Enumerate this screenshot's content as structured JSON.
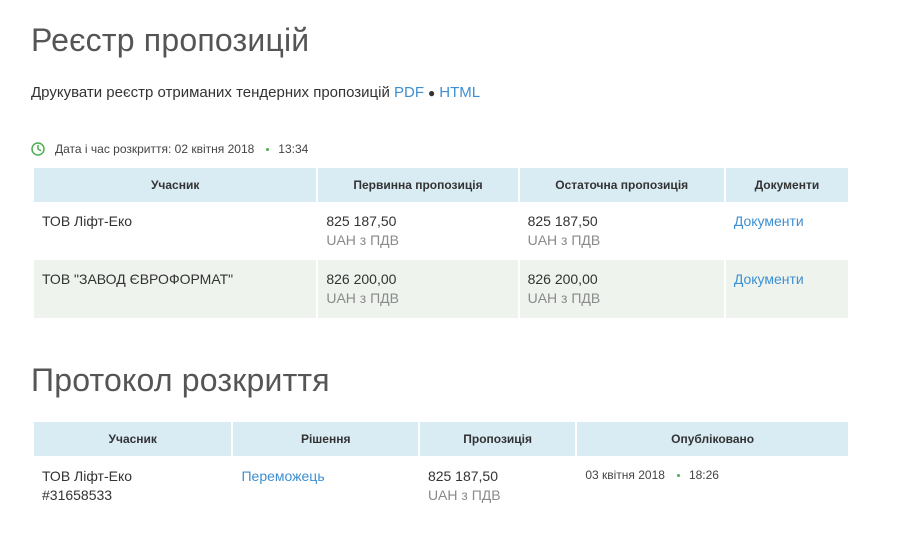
{
  "registry": {
    "title": "Реєстр пропозицій",
    "print_text": "Друкувати реєстр отриманих тендерних пропозицій",
    "pdf_link": "PDF",
    "dot": "●",
    "html_link": "HTML",
    "opened_label": "Дата і час розкриття: 02 квітня 2018",
    "opened_time": "13:34",
    "columns": [
      "Учасник",
      "Первинна пропозиція",
      "Остаточна пропозиція",
      "Документи"
    ],
    "rows": [
      {
        "participant": "ТОВ Ліфт-Еко",
        "initial_amount": "825 187,50",
        "initial_currency": "UAH з ПДВ",
        "final_amount": "825 187,50",
        "final_currency": "UAH з ПДВ",
        "documents": "Документи"
      },
      {
        "participant": "ТОВ \"ЗАВОД ЄВРОФОРМАТ\"",
        "initial_amount": "826 200,00",
        "initial_currency": "UAH з ПДВ",
        "final_amount": "826 200,00",
        "final_currency": "UAH з ПДВ",
        "documents": "Документи"
      }
    ]
  },
  "protocol": {
    "title": "Протокол розкриття",
    "columns": [
      "Учасник",
      "Рішення",
      "Пропозиція",
      "Опубліковано"
    ],
    "rows": [
      {
        "participant": "ТОВ Ліфт-Еко",
        "participant_id": "#31658533",
        "decision": "Переможець",
        "amount": "825 187,50",
        "currency": "UAH з ПДВ",
        "published_date": "03 квітня 2018",
        "published_time": "18:26"
      }
    ]
  },
  "colors": {
    "link": "#3d8fd1",
    "header_bg": "#d9ecf4",
    "alt_row_bg": "#eef3ee",
    "accent_green": "#4caf50"
  }
}
